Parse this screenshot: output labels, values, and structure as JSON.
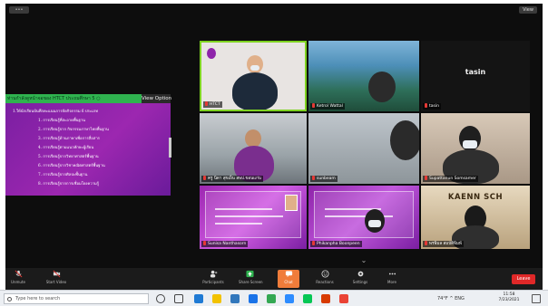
{
  "topbar": {
    "left_pill": "•••",
    "view_button": "View"
  },
  "share": {
    "header": "ท่านกำลังดูหน้าจอของ HTCT ประถมศึกษา 5  ○",
    "view_options": "View Option",
    "slide_lines": [
      "1.ให้นักเรียนบันทึกคะแนนการจัดกิจกรรม 6 ประเภท",
      "1. การเรียนรู้ที่สะอาดพื้นฐาน",
      "2. การเรียนรู้จาก กิจกรรมภาษาไทยพื้นฐาน",
      "3. การเรียนรู้ด้านภาษาเพื่อการสื่อสาร",
      "4. การเรียนรู้ตามแนวทักษะผู้เรียน",
      "5. การเรียนรู้จากวิทยาศาสตร์พื้นฐาน",
      "6. การเรียนรู้จากวิชาคณิตศาสตร์พื้นฐาน",
      "7. การเรียนรู้จากศิลปะพื้นฐาน",
      "8. การเรียนรู้จากการเชื่อมโยงความรู้"
    ]
  },
  "tiles": [
    {
      "name": "HTCT",
      "kind": "video"
    },
    {
      "name": "Ketrol Wattal",
      "kind": "video"
    },
    {
      "name": "tasin",
      "kind": "label",
      "label": "tasin"
    },
    {
      "name": "ครู นิดา สุขเย็น สพป.ขอนแก่น",
      "kind": "video"
    },
    {
      "name": "sunbeam",
      "kind": "video"
    },
    {
      "name": "Supattanun Somsamer",
      "kind": "video"
    },
    {
      "name": "Sunisa Nanthasorn",
      "kind": "slide"
    },
    {
      "name": "Phikanpha Boonpeen",
      "kind": "slide"
    },
    {
      "name": "พรพิมล สมบัติพิมพ์",
      "kind": "video",
      "banner": "KAENN   SCH"
    }
  ],
  "toolbar": {
    "buttons": [
      {
        "label": "Unmute",
        "icon": "microphone-icon"
      },
      {
        "label": "Start Video",
        "icon": "video-camera-icon"
      },
      {
        "label": "Participants",
        "icon": "participants-icon"
      },
      {
        "label": "Share Screen",
        "icon": "share-screen-icon"
      },
      {
        "label": "Chat",
        "icon": "chat-icon"
      },
      {
        "label": "Reactions",
        "icon": "reactions-icon"
      },
      {
        "label": "Settings",
        "icon": "settings-icon"
      },
      {
        "label": "More",
        "icon": "more-icon"
      }
    ],
    "leave": "Leave"
  },
  "taskbar": {
    "search_placeholder": "Type here to search",
    "tray": "74°F  ^  ENG",
    "time": "11:58",
    "date": "7/23/2021"
  },
  "colors": {
    "slide_purple": "#7b1fa2",
    "share_header_green": "#2fb34f",
    "leave_red": "#e02828",
    "active_speaker": "#7ed321"
  }
}
